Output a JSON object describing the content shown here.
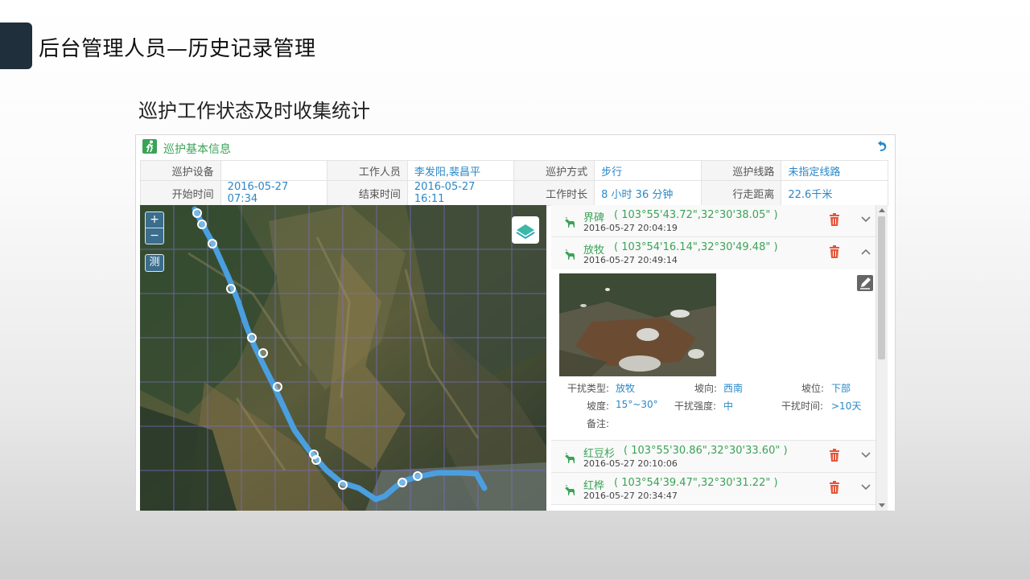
{
  "slide": {
    "title": "后台管理人员—历史记录管理",
    "subtitle": "巡护工作状态及时收集统计"
  },
  "panel": {
    "title": "巡护基本信息"
  },
  "info": {
    "row1": [
      {
        "label": "巡护设备",
        "value": ""
      },
      {
        "label": "工作人员",
        "value": "李发阳,裴昌平"
      },
      {
        "label": "巡护方式",
        "value": "步行"
      },
      {
        "label": "巡护线路",
        "value": "未指定线路"
      }
    ],
    "row2": [
      {
        "label": "开始时间",
        "value": "2016-05-27 07:34"
      },
      {
        "label": "结束时间",
        "value": "2016-05-27 16:11"
      },
      {
        "label": "工作时长",
        "value": "8 小时 36 分钟"
      },
      {
        "label": "行走距离",
        "value": "22.6千米"
      }
    ]
  },
  "map": {
    "zoom_in": "+",
    "zoom_out": "−",
    "measure": "测",
    "route_color": "#4a9fe0",
    "layer_icon": "layers-icon"
  },
  "records": [
    {
      "name": "界碑",
      "coord": "( 103°55'43.72\",32°30'38.05\" )",
      "time": "2016-05-27 20:04:19",
      "expanded": false
    },
    {
      "name": "放牧",
      "coord": "( 103°54'16.14\",32°30'49.48\" )",
      "time": "2016-05-27 20:49:14",
      "expanded": true,
      "details": {
        "type_label": "干扰类型:",
        "type_value": "放牧",
        "dir_label": "坡向:",
        "dir_value": "西南",
        "pos_label": "坡位:",
        "pos_value": "下部",
        "slope_label": "坡度:",
        "slope_value": "15°~30°",
        "intensity_label": "干扰强度:",
        "intensity_value": "中",
        "duration_label": "干扰时间:",
        "duration_value": ">10天",
        "note_label": "备注:"
      }
    },
    {
      "name": "红豆杉",
      "coord": "( 103°55'30.86\",32°30'33.60\" )",
      "time": "2016-05-27 20:10:06",
      "expanded": false
    },
    {
      "name": "红桦",
      "coord": "( 103°54'39.47\",32°30'31.22\" )",
      "time": "2016-05-27 20:34:47",
      "expanded": false
    }
  ],
  "colors": {
    "accent": "#1f2f3b",
    "green": "#3aa356",
    "blue": "#2a88c8",
    "trash": "#e8553a"
  }
}
